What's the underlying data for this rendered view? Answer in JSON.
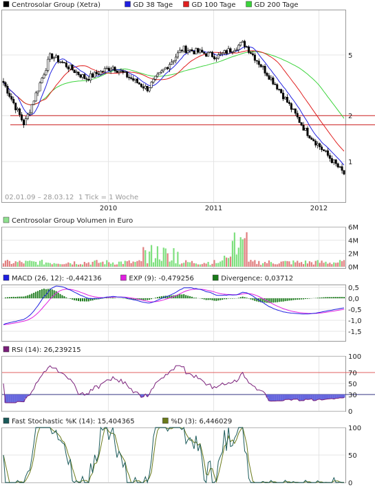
{
  "chart_data": [
    {
      "type": "candlestick",
      "panel": "price",
      "title": "",
      "legend": [
        {
          "name": "Centrosolar Group (Xetra)",
          "color": "#000000"
        },
        {
          "name": "GD 38 Tage",
          "color": "#1f1fe0"
        },
        {
          "name": "GD 100 Tage",
          "color": "#e01f1f"
        },
        {
          "name": "GD 200 Tage",
          "color": "#3bd43b"
        }
      ],
      "date_range_label": "02.01.09 – 28.03.12",
      "tick_label": "1 Tick = 1 Woche",
      "x_tick_labels": [
        "2010",
        "2011",
        "2012"
      ],
      "y_tick_labels": [
        "5",
        "2",
        "1"
      ],
      "y_scale": "log",
      "support_lines": [
        2.0,
        1.74
      ],
      "key_prices": [
        {
          "date": "2009-01",
          "price": 3.3
        },
        {
          "date": "2009-03",
          "price": 1.75
        },
        {
          "date": "2009-06",
          "price": 5.0
        },
        {
          "date": "2009-10",
          "price": 3.5
        },
        {
          "date": "2010-01",
          "price": 4.2
        },
        {
          "date": "2010-05",
          "price": 3.0
        },
        {
          "date": "2010-09",
          "price": 5.5
        },
        {
          "date": "2011-01",
          "price": 4.9
        },
        {
          "date": "2011-04",
          "price": 6.0
        },
        {
          "date": "2011-08",
          "price": 3.0
        },
        {
          "date": "2011-11",
          "price": 1.6
        },
        {
          "date": "2012-03",
          "price": 0.83
        }
      ]
    },
    {
      "type": "bar",
      "panel": "volume",
      "legend": [
        {
          "name": "Centrosolar Group Volumen in Euro",
          "color": "#8fe08f"
        }
      ],
      "y_tick_labels": [
        "6M",
        "4M",
        "2M",
        "0M"
      ],
      "ylim": [
        0,
        6
      ]
    },
    {
      "type": "line",
      "panel": "macd",
      "legend": [
        {
          "name": "MACD (26, 12): -0,442136",
          "color": "#1f1fe0"
        },
        {
          "name": "EXP (9): -0,479256",
          "color": "#e01fe0"
        },
        {
          "name": "Divergence: 0,03712",
          "color": "#1a7a1a"
        }
      ],
      "y_tick_labels": [
        "0,5",
        "0,0",
        "-0,5",
        "-1,0",
        "-1,5"
      ],
      "ylim": [
        -1.5,
        0.5
      ]
    },
    {
      "type": "line",
      "panel": "rsi",
      "legend": [
        {
          "name": "RSI (14): 26,239215",
          "color": "#7a1f7a"
        }
      ],
      "y_tick_labels": [
        "100",
        "70",
        "50",
        "30",
        "0"
      ],
      "ylim": [
        0,
        100
      ],
      "reference_lines": [
        70,
        30
      ]
    },
    {
      "type": "line",
      "panel": "stochastic",
      "legend": [
        {
          "name": "Fast Stochastic %K (14): 15,404365",
          "color": "#1a5a5a"
        },
        {
          "name": "%D (3): 6,446029",
          "color": "#6a7a1a"
        }
      ],
      "y_tick_labels": [
        "100",
        "50",
        "0"
      ],
      "ylim": [
        0,
        100
      ]
    }
  ]
}
